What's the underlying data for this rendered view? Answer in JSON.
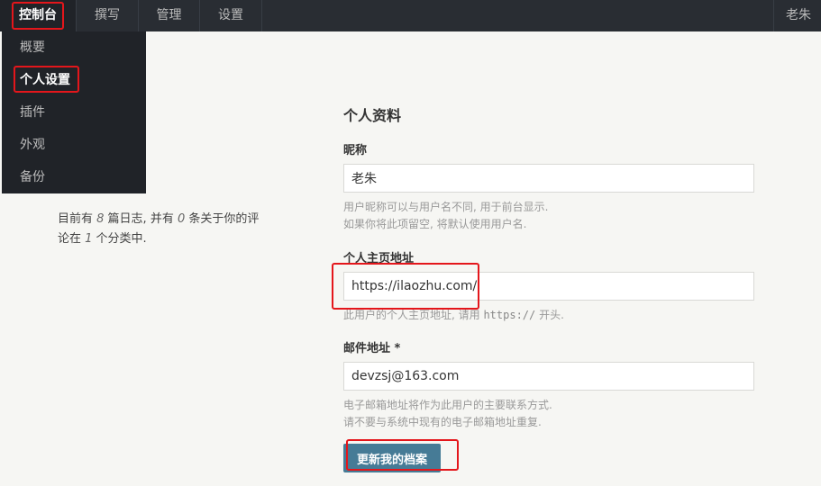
{
  "nav": {
    "items": [
      "控制台",
      "撰写",
      "管理",
      "设置"
    ],
    "user": "老朱"
  },
  "dropdown": {
    "items": [
      "概要",
      "个人设置",
      "插件",
      "外观",
      "备份"
    ]
  },
  "summary": {
    "p1": "目前有 ",
    "posts": "8",
    "p2": " 篇日志, 并有 ",
    "comments": "0",
    "p3": " 条关于你的评论在 ",
    "categories": "1",
    "p4": " 个分类中."
  },
  "profile": {
    "title": "个人资料",
    "nickname": {
      "label": "昵称",
      "value": "老朱",
      "desc1": "用户昵称可以与用户名不同, 用于前台显示.",
      "desc2": "如果你将此项留空, 将默认使用用户名."
    },
    "homepage": {
      "label": "个人主页地址",
      "value": "https://ilaozhu.com/",
      "desc_pre": "此用户的个人主页地址, 请用 ",
      "desc_code": "https://",
      "desc_post": " 开头."
    },
    "email": {
      "label": "邮件地址 *",
      "value": "devzsj@163.com",
      "desc1": "电子邮箱地址将作为此用户的主要联系方式.",
      "desc2": "请不要与系统中现有的电子邮箱地址重复."
    },
    "submit": "更新我的档案"
  },
  "colors": {
    "topbar": "#292d33",
    "dropdown": "#202328",
    "highlight": "#e4161b",
    "button": "#467b96"
  }
}
